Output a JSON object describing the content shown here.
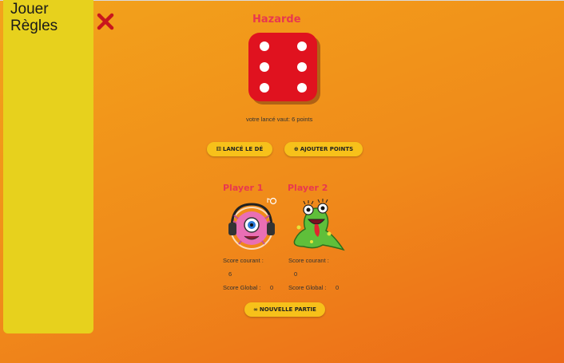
{
  "menu": {
    "items": [
      {
        "label": "Jouer"
      },
      {
        "label": "Règles"
      }
    ]
  },
  "game": {
    "title": "Hazarde",
    "die_value": 6,
    "roll_text": "votre lancé vaut: 6 points"
  },
  "buttons": {
    "roll_label": "LANCÉ LE DÉ",
    "roll_icon": "dice-icon",
    "hold_label": "AJOUTER POINTS",
    "hold_icon": "plus-circle-icon",
    "new_label": "NOUVELLE PARTIE",
    "new_icon": "infinity-icon"
  },
  "players": [
    {
      "name": "Player 1",
      "avatar": "pink-monster-headphones",
      "current_label": "Score courant :",
      "current_score": "6",
      "global_label": "Score Global :",
      "global_score": "0"
    },
    {
      "name": "Player 2",
      "avatar": "green-monster",
      "current_label": "Score courant :",
      "current_score": "0",
      "global_label": "Score Global :",
      "global_score": "0"
    }
  ],
  "colors": {
    "accent": "#e8384f",
    "button": "#f7c11a",
    "sidebar": "#e7d11d",
    "die": "#e0121f"
  }
}
